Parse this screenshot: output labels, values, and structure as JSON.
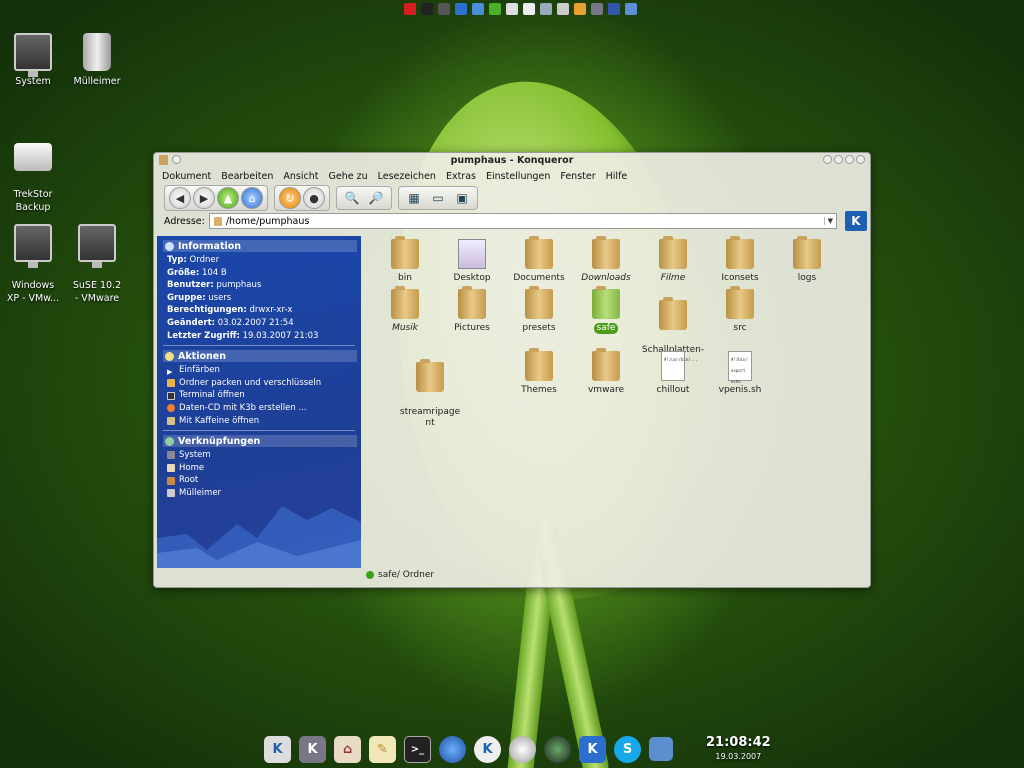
{
  "desktop": {
    "icons": [
      {
        "label": "System"
      },
      {
        "label": "Mülleimer"
      },
      {
        "label": "TrekStor\nBackup"
      },
      {
        "label": "Windows\nXP - VMw..."
      },
      {
        "label": "SuSE 10.2\n- VMware"
      }
    ]
  },
  "window": {
    "title": "pumphaus - Konqueror",
    "menu": [
      "Dokument",
      "Bearbeiten",
      "Ansicht",
      "Gehe zu",
      "Lesezeichen",
      "Extras",
      "Einstellungen",
      "Fenster",
      "Hilfe"
    ],
    "address_label": "Adresse:",
    "address_value": "/home/pumphaus",
    "status_text": "safe/  Ordner"
  },
  "sidebar": {
    "info_header": "Information",
    "info_rows": [
      {
        "key": "Typ:",
        "value": "Ordner"
      },
      {
        "key": "Größe:",
        "value": "104 B"
      },
      {
        "key": "Benutzer:",
        "value": "pumphaus"
      },
      {
        "key": "Gruppe:",
        "value": "users"
      },
      {
        "key": "Berechtigungen:",
        "value": "drwxr-xr-x"
      },
      {
        "key": "Geändert:",
        "value": "03.02.2007 21:54"
      },
      {
        "key": "Letzter Zugriff:",
        "value": "19.03.2007 21:03"
      }
    ],
    "actions_header": "Aktionen",
    "actions": [
      "Einfärben",
      "Ordner packen und verschlüsseln",
      "Terminal öffnen",
      "Daten-CD mit K3b erstellen ...",
      "Mit Kaffeine öffnen"
    ],
    "links_header": "Verknüpfungen",
    "links": [
      "System",
      "Home",
      "Root",
      "Mülleimer"
    ]
  },
  "files": [
    {
      "name": "bin",
      "type": "folder"
    },
    {
      "name": "Desktop",
      "type": "desktop"
    },
    {
      "name": "Documents",
      "type": "folder"
    },
    {
      "name": "Downloads",
      "type": "folder",
      "italic": true
    },
    {
      "name": "Filme",
      "type": "folder",
      "italic": true
    },
    {
      "name": "Iconsets",
      "type": "folder"
    },
    {
      "name": "logs",
      "type": "folder"
    },
    {
      "name": "Musik",
      "type": "folder",
      "italic": true
    },
    {
      "name": "Pictures",
      "type": "folder"
    },
    {
      "name": "presets",
      "type": "folder"
    },
    {
      "name": "safe",
      "type": "folder-green",
      "selected": true
    },
    {
      "name": "Schallplatten-\nRip",
      "type": "folder"
    },
    {
      "name": "src",
      "type": "folder"
    },
    {
      "name": "streamripage\nnt",
      "type": "folder"
    },
    {
      "name": "Themes",
      "type": "folder"
    },
    {
      "name": "vmware",
      "type": "folder"
    },
    {
      "name": "chillout",
      "type": "doc",
      "preview": "#!/usr/bin/..."
    },
    {
      "name": "vpenis.sh",
      "type": "doc",
      "preview": "#!/bin/\nexport\necho"
    }
  ],
  "clock": {
    "time": "21:08:42",
    "date": "19.03.2007"
  },
  "colors": {
    "sidebar": "#1e3f96",
    "selection": "#4e9a1a",
    "folder": "#d9b26a"
  }
}
